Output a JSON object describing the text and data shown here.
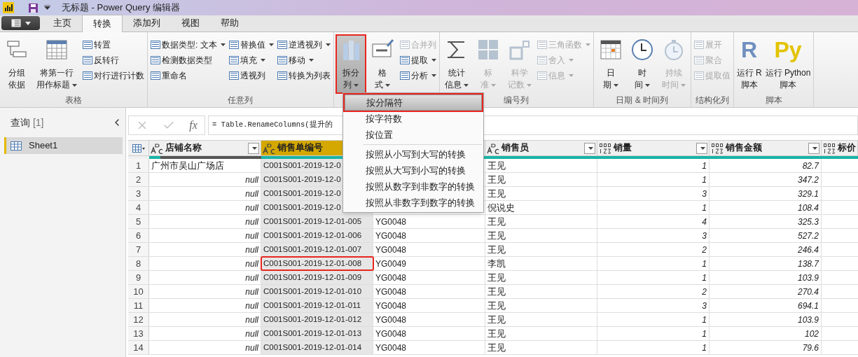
{
  "window": {
    "title": "无标题 - Power Query 编辑器"
  },
  "tabs": [
    {
      "label": "主页",
      "selected": false
    },
    {
      "label": "转换",
      "selected": true
    },
    {
      "label": "添加列",
      "selected": false
    },
    {
      "label": "视图",
      "selected": false
    },
    {
      "label": "帮助",
      "selected": false
    }
  ],
  "ribbon": [
    {
      "label": "表格",
      "columns": [
        {
          "kind": "large",
          "lines": [
            "分组",
            "依据"
          ],
          "dropdown": false,
          "disabled": false,
          "pressed": false,
          "outlined": false
        },
        {
          "kind": "large",
          "lines": [
            "将第一行",
            "用作标题"
          ],
          "dropdown": true,
          "disabled": false,
          "pressed": false,
          "outlined": false
        },
        {
          "kind": "small",
          "items": [
            {
              "label": "转置",
              "dropdown": false,
              "disabled": false
            },
            {
              "label": "反转行",
              "dropdown": false,
              "disabled": false
            },
            {
              "label": "对行进行计数",
              "dropdown": false,
              "disabled": false
            }
          ]
        }
      ]
    },
    {
      "label": "任意列",
      "columns": [
        {
          "kind": "small",
          "items": [
            {
              "label": "数据类型: 文本",
              "dropdown": true,
              "disabled": false
            },
            {
              "label": "检测数据类型",
              "dropdown": false,
              "disabled": false
            },
            {
              "label": "重命名",
              "dropdown": false,
              "disabled": false
            }
          ]
        },
        {
          "kind": "small",
          "items": [
            {
              "label": "替换值",
              "dropdown": true,
              "disabled": false
            },
            {
              "label": "填充",
              "dropdown": true,
              "disabled": false
            },
            {
              "label": "透视列",
              "dropdown": false,
              "disabled": false
            }
          ]
        },
        {
          "kind": "small",
          "items": [
            {
              "label": "逆透视列",
              "dropdown": true,
              "disabled": false
            },
            {
              "label": "移动",
              "dropdown": true,
              "disabled": false
            },
            {
              "label": "转换为列表",
              "dropdown": false,
              "disabled": false
            }
          ]
        }
      ]
    },
    {
      "columns": [
        {
          "kind": "large",
          "lines": [
            "拆分",
            "列"
          ],
          "dropdown": true,
          "disabled": false,
          "pressed": true,
          "outlined": true
        },
        {
          "kind": "large",
          "lines": [
            "格",
            "式"
          ],
          "dropdown": true,
          "disabled": false,
          "pressed": false,
          "outlined": false
        },
        {
          "kind": "small",
          "items": [
            {
              "label": "合并列",
              "dropdown": false,
              "disabled": true
            },
            {
              "label": "提取",
              "dropdown": true,
              "disabled": false
            },
            {
              "label": "分析",
              "dropdown": true,
              "disabled": false
            }
          ]
        }
      ]
    },
    {
      "label": "编号列",
      "columns": [
        {
          "kind": "large",
          "lines": [
            "统计",
            "信息"
          ],
          "dropdown": true,
          "disabled": false,
          "pressed": false,
          "outlined": false
        },
        {
          "kind": "large",
          "lines": [
            "标",
            "准"
          ],
          "dropdown": true,
          "disabled": true,
          "pressed": false,
          "outlined": false
        },
        {
          "kind": "large",
          "lines": [
            "科学",
            "记数"
          ],
          "dropdown": true,
          "disabled": true,
          "pressed": false,
          "outlined": false
        },
        {
          "kind": "small",
          "items": [
            {
              "label": "三角函数",
              "dropdown": true,
              "disabled": true
            },
            {
              "label": "舍入",
              "dropdown": true,
              "disabled": true
            },
            {
              "label": "信息",
              "dropdown": true,
              "disabled": true
            }
          ]
        }
      ]
    },
    {
      "label": "日期 & 时间列",
      "columns": [
        {
          "kind": "large",
          "lines": [
            "日",
            "期"
          ],
          "dropdown": true,
          "disabled": false,
          "pressed": false,
          "outlined": false
        },
        {
          "kind": "large",
          "lines": [
            "时",
            "间"
          ],
          "dropdown": true,
          "disabled": false,
          "pressed": false,
          "outlined": false
        },
        {
          "kind": "large",
          "lines": [
            "持续",
            "时间"
          ],
          "dropdown": true,
          "disabled": true,
          "pressed": false,
          "outlined": false
        }
      ]
    },
    {
      "label": "结构化列",
      "columns": [
        {
          "kind": "small",
          "items": [
            {
              "label": "展开",
              "dropdown": false,
              "disabled": true
            },
            {
              "label": "聚合",
              "dropdown": false,
              "disabled": true
            },
            {
              "label": "提取值",
              "dropdown": false,
              "disabled": true
            }
          ]
        }
      ]
    },
    {
      "label": "脚本",
      "columns": [
        {
          "kind": "script",
          "glyph": "R",
          "lines": [
            "运行 R",
            "脚本"
          ],
          "color": "#6f8fbf"
        },
        {
          "kind": "script",
          "glyph": "Py",
          "lines": [
            "运行 Python",
            "脚本"
          ],
          "color": "#e3c300"
        }
      ]
    }
  ],
  "menu": [
    {
      "label": "按分隔符",
      "highlighted": true,
      "outlined": true,
      "separator_before": false
    },
    {
      "label": "按字符数",
      "highlighted": false,
      "outlined": false,
      "separator_before": false
    },
    {
      "label": "按位置",
      "highlighted": false,
      "outlined": false,
      "separator_before": false
    },
    {
      "label": "按照从小写到大写的转换",
      "highlighted": false,
      "outlined": false,
      "separator_before": true
    },
    {
      "label": "按照从大写到小写的转换",
      "highlighted": false,
      "outlined": false,
      "separator_before": false
    },
    {
      "label": "按照从数字到非数字的转换",
      "highlighted": false,
      "outlined": false,
      "separator_before": false
    },
    {
      "label": "按照从非数字到数字的转换",
      "highlighted": false,
      "outlined": false,
      "separator_before": false
    }
  ],
  "queries": {
    "title": "查询",
    "count": "[1]",
    "items": [
      {
        "label": "Sheet1",
        "selected": true
      }
    ]
  },
  "formula_bar": {
    "fx": "fx",
    "formula": "= Table.RenameColumns(提升的"
  },
  "table": {
    "columns": [
      {
        "label": "店铺名称",
        "kind": "text",
        "selected": false,
        "filter": true
      },
      {
        "label": "销售单编号",
        "kind": "text",
        "selected": true,
        "filter": false
      },
      {
        "kind": "blank",
        "selected": false,
        "filter": false
      },
      {
        "label": "销售员",
        "kind": "text",
        "selected": false,
        "filter": true
      },
      {
        "label": "销量",
        "kind": "any",
        "selected": false,
        "filter": true
      },
      {
        "label": "销售金额",
        "kind": "any",
        "selected": false,
        "filter": true
      },
      {
        "label": "标价",
        "kind": "any",
        "selected": false
      }
    ],
    "rows": [
      {
        "number": "1",
        "store": "广州市吴山广场店",
        "store_null": false,
        "order": "C001S001-2019-12-0",
        "order_outlined": false,
        "seller": "王见",
        "qty": "1",
        "amount": "82.7"
      },
      {
        "number": "2",
        "store": "null",
        "store_null": true,
        "order": "C001S001-2019-12-0",
        "order_outlined": false,
        "seller": "王见",
        "qty": "1",
        "amount": "347.2"
      },
      {
        "number": "3",
        "store": "null",
        "store_null": true,
        "order": "C001S001-2019-12-0",
        "order_outlined": false,
        "seller": "王见",
        "qty": "3",
        "amount": "329.1"
      },
      {
        "number": "4",
        "store": "null",
        "store_null": true,
        "order": "C001S001-2019-12-0",
        "order_outlined": false,
        "seller": "倪说史",
        "qty": "1",
        "amount": "108.4"
      },
      {
        "number": "5",
        "store": "null",
        "store_null": true,
        "order": "C001S001-2019-12-01-005",
        "order_outlined": false,
        "column_3": "YG0048",
        "seller": "王见",
        "qty": "4",
        "amount": "325.3"
      },
      {
        "number": "6",
        "store": "null",
        "store_null": true,
        "order": "C001S001-2019-12-01-006",
        "order_outlined": false,
        "column_3": "YG0048",
        "seller": "王见",
        "qty": "3",
        "amount": "527.2"
      },
      {
        "number": "7",
        "store": "null",
        "store_null": true,
        "order": "C001S001-2019-12-01-007",
        "order_outlined": false,
        "column_3": "YG0048",
        "seller": "王见",
        "qty": "2",
        "amount": "246.4"
      },
      {
        "number": "8",
        "store": "null",
        "store_null": true,
        "order": "C001S001-2019-12-01-008",
        "order_outlined": true,
        "column_3": "YG0049",
        "seller": "李凯",
        "qty": "1",
        "amount": "138.7"
      },
      {
        "number": "9",
        "store": "null",
        "store_null": true,
        "order": "C001S001-2019-12-01-009",
        "order_outlined": false,
        "column_3": "YG0048",
        "seller": "王见",
        "qty": "1",
        "amount": "103.9"
      },
      {
        "number": "10",
        "store": "null",
        "store_null": true,
        "order": "C001S001-2019-12-01-010",
        "order_outlined": false,
        "column_3": "YG0048",
        "seller": "王见",
        "qty": "2",
        "amount": "270.4"
      },
      {
        "number": "11",
        "store": "null",
        "store_null": true,
        "order": "C001S001-2019-12-01-011",
        "order_outlined": false,
        "column_3": "YG0048",
        "seller": "王见",
        "qty": "3",
        "amount": "694.1"
      },
      {
        "number": "12",
        "store": "null",
        "store_null": true,
        "order": "C001S001-2019-12-01-012",
        "order_outlined": false,
        "column_3": "YG0048",
        "seller": "王见",
        "qty": "1",
        "amount": "103.9"
      },
      {
        "number": "13",
        "store": "null",
        "store_null": true,
        "order": "C001S001-2019-12-01-013",
        "order_outlined": false,
        "column_3": "YG0048",
        "seller": "王见",
        "qty": "1",
        "amount": "102"
      },
      {
        "number": "14",
        "store": "null",
        "store_null": true,
        "order": "C001S001-2019-12-01-014",
        "order_outlined": false,
        "column_3": "YG0048",
        "seller": "王见",
        "qty": "1",
        "amount": "79.6"
      }
    ]
  }
}
